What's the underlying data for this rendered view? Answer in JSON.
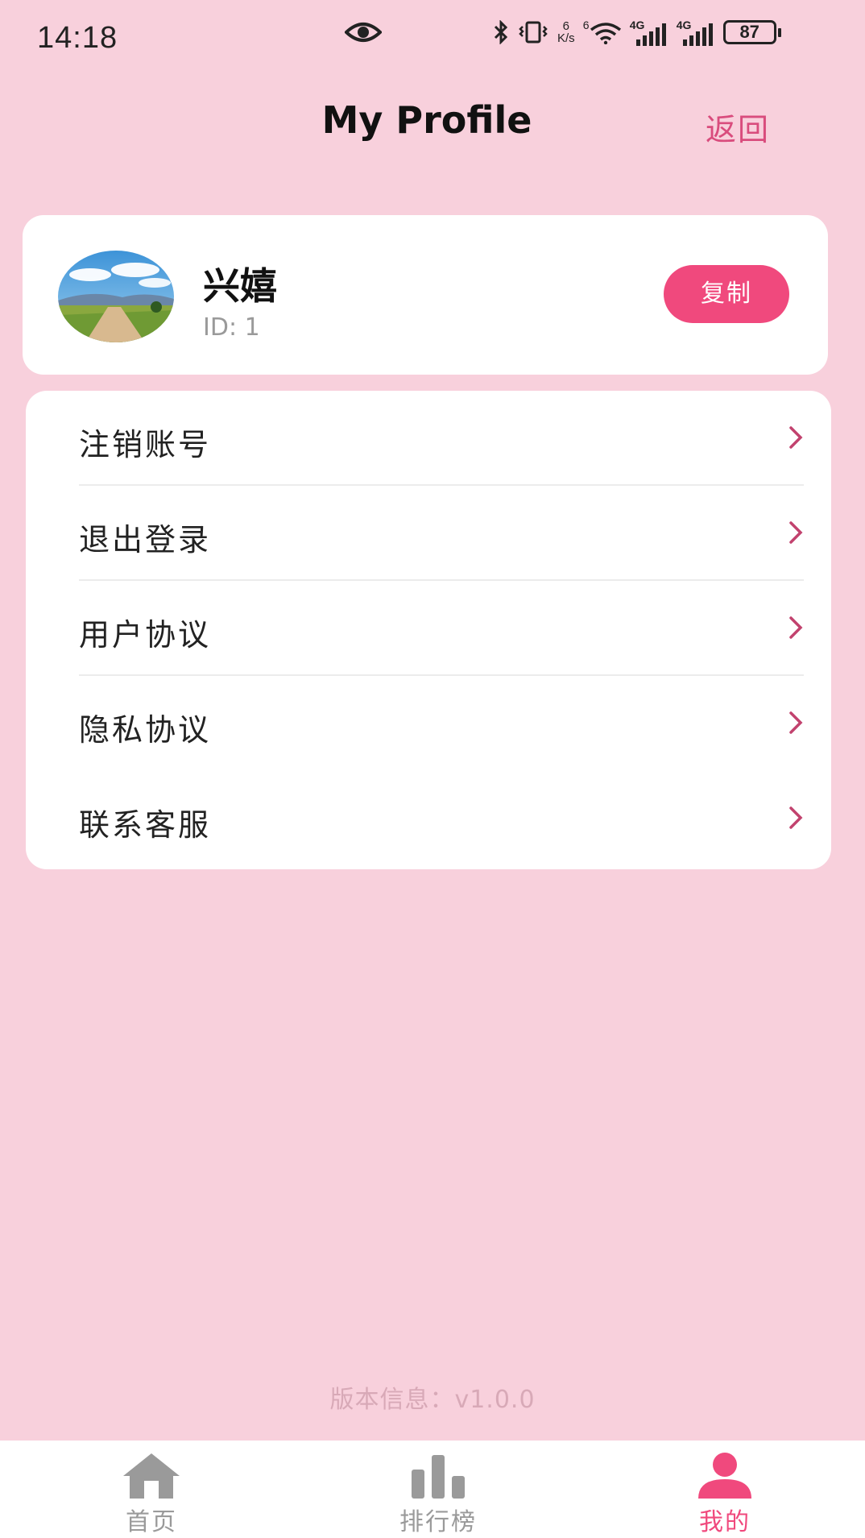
{
  "status_bar": {
    "time": "14:18",
    "netspeed_value": "6",
    "netspeed_unit": "K/s",
    "wifi_badge": "6",
    "sim1_label": "4G",
    "sim2_label": "4G",
    "battery": "87",
    "icons": [
      "eye-icon",
      "bluetooth-icon",
      "vibrate-icon",
      "wifi-icon",
      "signal-icon",
      "signal-icon",
      "battery-icon"
    ]
  },
  "header": {
    "title": "My Profile",
    "back_label": "返回"
  },
  "profile": {
    "name": "兴嬉",
    "id_text": "ID: 1",
    "copy_label": "复制"
  },
  "menu": {
    "items": [
      {
        "label": "注销账号"
      },
      {
        "label": "退出登录"
      },
      {
        "label": "用户协议"
      },
      {
        "label": "隐私协议"
      },
      {
        "label": "联系客服"
      }
    ]
  },
  "footer": {
    "version": "版本信息：v1.0.0"
  },
  "tabs": [
    {
      "label": "首页",
      "icon": "home-icon",
      "active": false
    },
    {
      "label": "排行榜",
      "icon": "ranking-icon",
      "active": false
    },
    {
      "label": "我的",
      "icon": "profile-icon",
      "active": true
    }
  ],
  "colors": {
    "background": "#f8d0dc",
    "accent": "#f0497d",
    "back_link": "#d94c7d",
    "chevron": "#c2426e"
  }
}
